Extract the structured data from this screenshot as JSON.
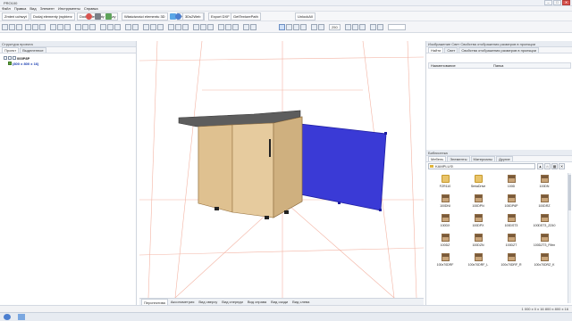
{
  "app": {
    "title": "PRO100",
    "window_buttons": [
      "–",
      "□",
      "✕"
    ]
  },
  "menu": [
    "Файл",
    "Правка",
    "Вид",
    "Элемент",
    "Инструменты",
    "Справка"
  ],
  "toolbar": {
    "buttons": [
      "Zmień uchwyt",
      "Dodaj elementy (wybierz",
      "Dodaj elementy z bazy",
      "Właściwości elementu 3D",
      "Project export",
      "Export DXF",
      "Explode",
      "3Ds2Web",
      "GetTexturePath",
      "UnlockAll"
    ]
  },
  "zoom": "250",
  "left_panel": {
    "title": "Структура проекта",
    "tabs": [
      "Проект",
      "Выделенное"
    ],
    "tree": [
      {
        "label": "000Р8Р",
        "style": "strong"
      },
      {
        "label": "(800 x 800 x 16)",
        "style": "blue"
      }
    ]
  },
  "viewport": {
    "tabs": [
      "Перспектива",
      "Аксонометрия",
      "Вид сверху",
      "Вид спереди",
      "Вид справа",
      "Вид сзади",
      "Вид слева"
    ]
  },
  "right_panel": {
    "title": "Изображение  Свет  Свойства отображения размеров в проекции",
    "tabs": [
      "Найти",
      "Свет",
      "Свойства отображения размеров в проекции"
    ],
    "grid_headers": [
      "Наименование",
      "Папка"
    ],
    "library": {
      "title": "Библиотека",
      "tabs": [
        "Мебель",
        "Элементы",
        "Материалы",
        "Другие"
      ],
      "path": "KAMPLUS\\",
      "items": [
        {
          "label": "FZR110",
          "type": "folder"
        },
        {
          "label": "SeriaDrive",
          "type": "folder"
        },
        {
          "label": "100D",
          "type": "box"
        },
        {
          "label": "100DN",
          "type": "box"
        },
        {
          "label": "100DNI",
          "type": "box"
        },
        {
          "label": "100DPN",
          "type": "box"
        },
        {
          "label": "100DP6P",
          "type": "box"
        },
        {
          "label": "100DRZ",
          "type": "box"
        },
        {
          "label": "100DX",
          "type": "box"
        },
        {
          "label": "100DPX",
          "type": "box"
        },
        {
          "label": "100DST3",
          "type": "box"
        },
        {
          "label": "100DST3_ZZ40",
          "type": "box"
        },
        {
          "label": "100DZ",
          "type": "box"
        },
        {
          "label": "100DZN",
          "type": "box"
        },
        {
          "label": "100DZT",
          "type": "box"
        },
        {
          "label": "100DZT3_Filtrn",
          "type": "box"
        },
        {
          "label": "100x70DRF",
          "type": "box"
        },
        {
          "label": "100x70DRF_L",
          "type": "box"
        },
        {
          "label": "100x70DRF_R",
          "type": "box"
        },
        {
          "label": "100x70DRZ_K",
          "type": "box"
        }
      ]
    }
  },
  "status": {
    "left": "",
    "right": "1 000 x 0 x 16   800 x 800 x 16"
  },
  "taskbar": {
    "time": ""
  }
}
